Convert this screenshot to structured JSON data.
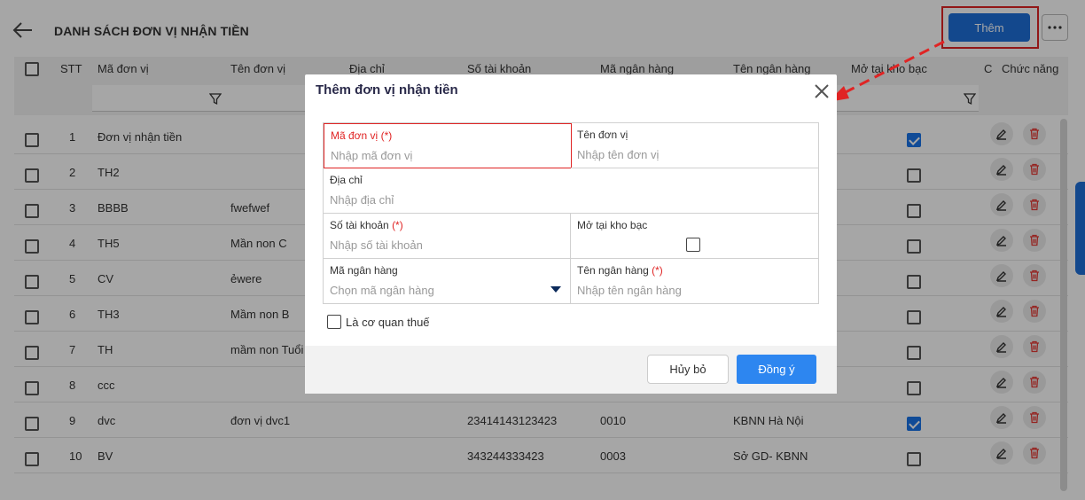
{
  "header": {
    "title": "DANH SÁCH ĐƠN VỊ NHẬN TIỀN",
    "add_label": "Thêm"
  },
  "table": {
    "columns": [
      "STT",
      "Mã đơn vị",
      "Tên đơn vị",
      "Địa chỉ",
      "Số tài khoản",
      "Mã ngân hàng",
      "Tên ngân hàng",
      "Mở tại kho bạc",
      "C",
      "Chức năng"
    ],
    "rows": [
      {
        "stt": "1",
        "code": "Đơn vị nhận tiền",
        "name": "",
        "account": "",
        "bank_code": "",
        "bank_name": "",
        "kho_bac": true
      },
      {
        "stt": "2",
        "code": "TH2",
        "name": "",
        "account": "",
        "bank_code": "",
        "bank_name": "",
        "kho_bac": false
      },
      {
        "stt": "3",
        "code": "BBBB",
        "name": "fwefwef",
        "account": "",
        "bank_code": "",
        "bank_name": "",
        "kho_bac": false
      },
      {
        "stt": "4",
        "code": "TH5",
        "name": "Mần non C",
        "account": "",
        "bank_code": "",
        "bank_name": "",
        "kho_bac": false
      },
      {
        "stt": "5",
        "code": "CV",
        "name": "ẻwere",
        "account": "",
        "bank_code": "",
        "bank_name": "",
        "kho_bac": false
      },
      {
        "stt": "6",
        "code": "TH3",
        "name": "Mầm non B",
        "account": "",
        "bank_code": "",
        "bank_name": "",
        "kho_bac": false
      },
      {
        "stt": "7",
        "code": "TH",
        "name": "mầm non Tuổi",
        "account": "",
        "bank_code": "",
        "bank_name": "",
        "kho_bac": false
      },
      {
        "stt": "8",
        "code": "ccc",
        "name": "",
        "account": "",
        "bank_code": "",
        "bank_name": "",
        "kho_bac": false
      },
      {
        "stt": "9",
        "code": "dvc",
        "name": "đơn vị dvc1",
        "account": "23414143123423",
        "bank_code": "0010",
        "bank_name": "KBNN Hà Nội",
        "kho_bac": true
      },
      {
        "stt": "10",
        "code": "BV",
        "name": "",
        "account": "343244333423",
        "bank_code": "0003",
        "bank_name": "Sở GD- KBNN",
        "kho_bac": false
      }
    ]
  },
  "modal": {
    "title": "Thêm đơn vị nhận tiền",
    "fields": {
      "code": {
        "label": "Mã đơn vị",
        "required": "(*)",
        "placeholder": "Nhập mã đơn vị"
      },
      "name": {
        "label": "Tên đơn vị",
        "placeholder": "Nhập tên đơn vị"
      },
      "address": {
        "label": "Địa chỉ",
        "placeholder": "Nhập địa chỉ"
      },
      "account": {
        "label": "Số tài khoản",
        "required": "(*)",
        "placeholder": "Nhập số tài khoản"
      },
      "kho_bac": {
        "label": "Mở tại kho bạc"
      },
      "bank_code": {
        "label": "Mã ngân hàng",
        "placeholder": "Chọn mã ngân hàng"
      },
      "bank_name": {
        "label": "Tên ngân hàng",
        "required": "(*)",
        "placeholder": "Nhập tên ngân hàng"
      }
    },
    "tax_label": "Là cơ quan thuế",
    "cancel_label": "Hủy bỏ",
    "ok_label": "Đồng ý"
  },
  "colors": {
    "primary": "#1e6fd9",
    "highlight": "#e02424",
    "danger": "#e53935"
  }
}
